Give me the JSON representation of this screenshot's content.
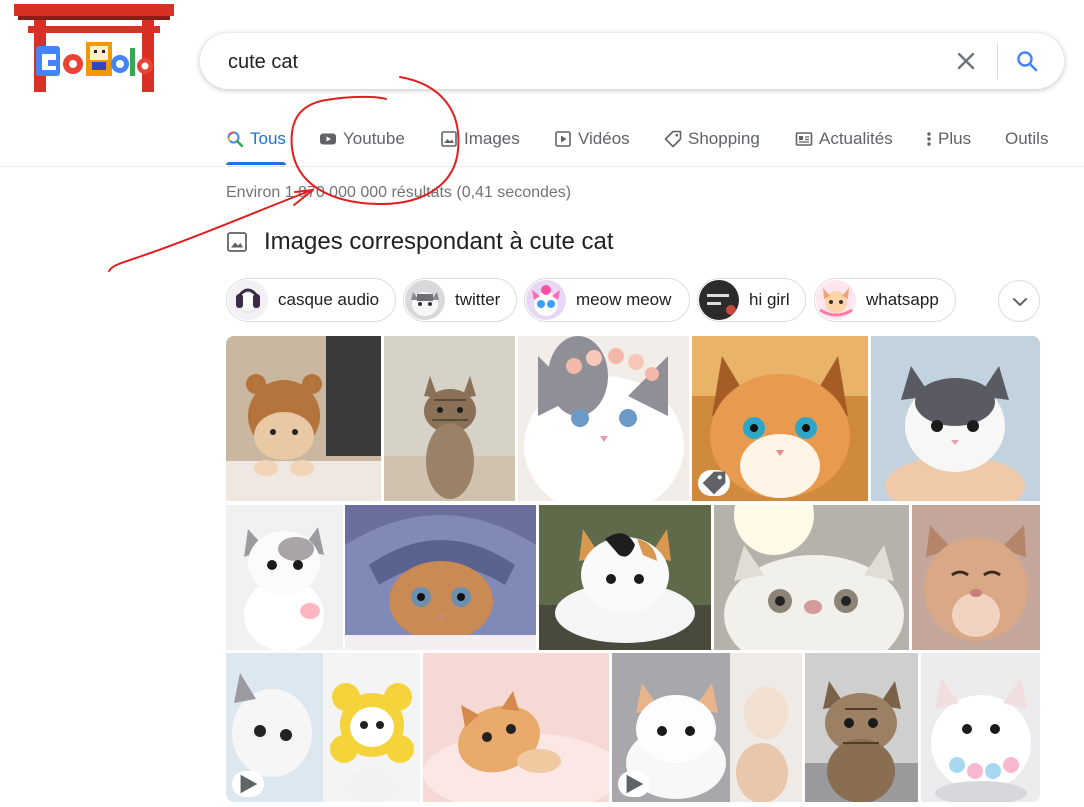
{
  "search": {
    "query": "cute cat",
    "clear_icon": "close-icon",
    "submit_icon": "search-icon"
  },
  "logo": {
    "alt": "Google",
    "icon": "google-doodle-logo"
  },
  "tabs": [
    {
      "label": "Tous",
      "icon": "search-icon",
      "active": true
    },
    {
      "label": "Youtube",
      "icon": "youtube-play-icon"
    },
    {
      "label": "Images",
      "icon": "image-icon"
    },
    {
      "label": "Vidéos",
      "icon": "video-icon"
    },
    {
      "label": "Shopping",
      "icon": "tag-icon"
    },
    {
      "label": "Actualités",
      "icon": "news-icon"
    },
    {
      "label": "Plus",
      "icon": "more-vertical-icon"
    },
    {
      "label": "Outils"
    }
  ],
  "stats": "Environ 1 870 000 000 résultats (0,41 secondes)",
  "images_section": {
    "title": "Images correspondant à cute cat",
    "icon": "image-icon",
    "chips": [
      {
        "label": "casque audio"
      },
      {
        "label": "twitter"
      },
      {
        "label": "meow meow"
      },
      {
        "label": "hi girl"
      },
      {
        "label": "whatsapp"
      }
    ],
    "expand_icon": "chevron-down-icon"
  },
  "colors": {
    "accent": "#1a73e8",
    "text_secondary": "#5f6368",
    "annotation": "#e02020"
  }
}
